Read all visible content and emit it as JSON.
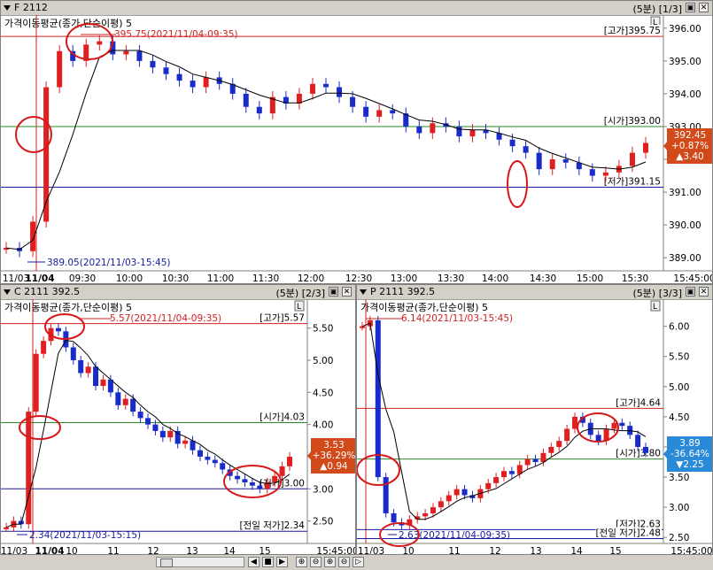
{
  "colors": {
    "up": "#e02020",
    "down": "#1a2cc8",
    "high": "#d02020",
    "open": "#2a8a2a",
    "low": "#1a1aa0",
    "ma": "#000000",
    "circle": "#d61818"
  },
  "panels": [
    {
      "id": "f2112",
      "title": "F 2112",
      "period": "(5분)",
      "index": "[1/3]",
      "indicator": "가격이동평균(종가,단순이평) 5",
      "current": {
        "price": "392.45",
        "change": "+0.87%",
        "diff": "▲3.40",
        "bg": "#d24a1a"
      },
      "levels": [
        {
          "kind": "high",
          "label": "[고가]395.75",
          "value": 395.75
        },
        {
          "kind": "open",
          "label": "[시가]393.00",
          "value": 393.0
        },
        {
          "kind": "low",
          "label": "[저가]391.15",
          "value": 391.15
        }
      ],
      "ref_annotations": [
        "395.75(2021/11/04-09:35)",
        "389.05(2021/11/03-15:45)"
      ],
      "y_ticks": [
        "396.00",
        "395.00",
        "394.00",
        "393.00",
        "392.00",
        "391.00",
        "390.00",
        "389.00"
      ],
      "x_labels": [
        "11/03",
        "11/04",
        "09:30",
        "10:00",
        "10:30",
        "11:00",
        "11:30",
        "12:00",
        "12:30",
        "13:00",
        "13:30",
        "14:00",
        "14:30",
        "15:00",
        "15:30",
        "15:45:00"
      ]
    },
    {
      "id": "c2111",
      "title": "C 2111 392.5",
      "period": "(5분)",
      "index": "[2/3]",
      "indicator": "가격이동평균(종가,단순이평) 5",
      "current": {
        "price": "3.53",
        "change": "+36.29%",
        "diff": "▲0.94",
        "bg": "#d24a1a"
      },
      "levels": [
        {
          "kind": "high",
          "label": "[고가]5.57"
        },
        {
          "kind": "open",
          "label": "[시가]4.03"
        },
        {
          "kind": "low",
          "label": "[저가]3.00"
        },
        {
          "kind": "prev_low",
          "label": "[전일 저가]2.34"
        }
      ],
      "ref_annotations": [
        "5.57(2021/11/04-09:35)",
        "2.34(2021/11/03-15:15)"
      ],
      "y_ticks": [
        "5.50",
        "5.00",
        "4.50",
        "4.00",
        "3.50",
        "3.00",
        "2.50"
      ],
      "x_labels": [
        "11/03",
        "11/04",
        "10",
        "11",
        "12",
        "13",
        "14",
        "15",
        "15:45:00"
      ]
    },
    {
      "id": "p2111",
      "title": "P 2111 392.5",
      "period": "(5분)",
      "index": "[3/3]",
      "indicator": "가격이동평균(종가,단순이평) 5",
      "current": {
        "price": "3.89",
        "change": "-36.64%",
        "diff": "▼2.25",
        "bg": "#2a8ad8"
      },
      "levels": [
        {
          "kind": "high",
          "label": "[고가]4.64"
        },
        {
          "kind": "open",
          "label": "[시가]3.80"
        },
        {
          "kind": "low",
          "label": "[저가]2.63"
        },
        {
          "kind": "prev_low",
          "label": "[전일 저가]2.48"
        }
      ],
      "ref_annotations": [
        "6.14(2021/11/03-15:45)",
        "2.63(2021/11/04-09:35)"
      ],
      "y_ticks": [
        "6.00",
        "5.50",
        "5.00",
        "4.50",
        "4.00",
        "3.50",
        "3.00",
        "2.50"
      ],
      "x_labels": [
        "11/03",
        "10",
        "11",
        "12",
        "13",
        "14",
        "15",
        "15:45:00"
      ]
    }
  ],
  "toolbar": {
    "scroll_icon": "scroll-handle-icon",
    "buttons": [
      "◀",
      "■",
      "▶",
      "⊕",
      "⊖",
      "⊕",
      "⊖",
      "▷"
    ]
  }
}
